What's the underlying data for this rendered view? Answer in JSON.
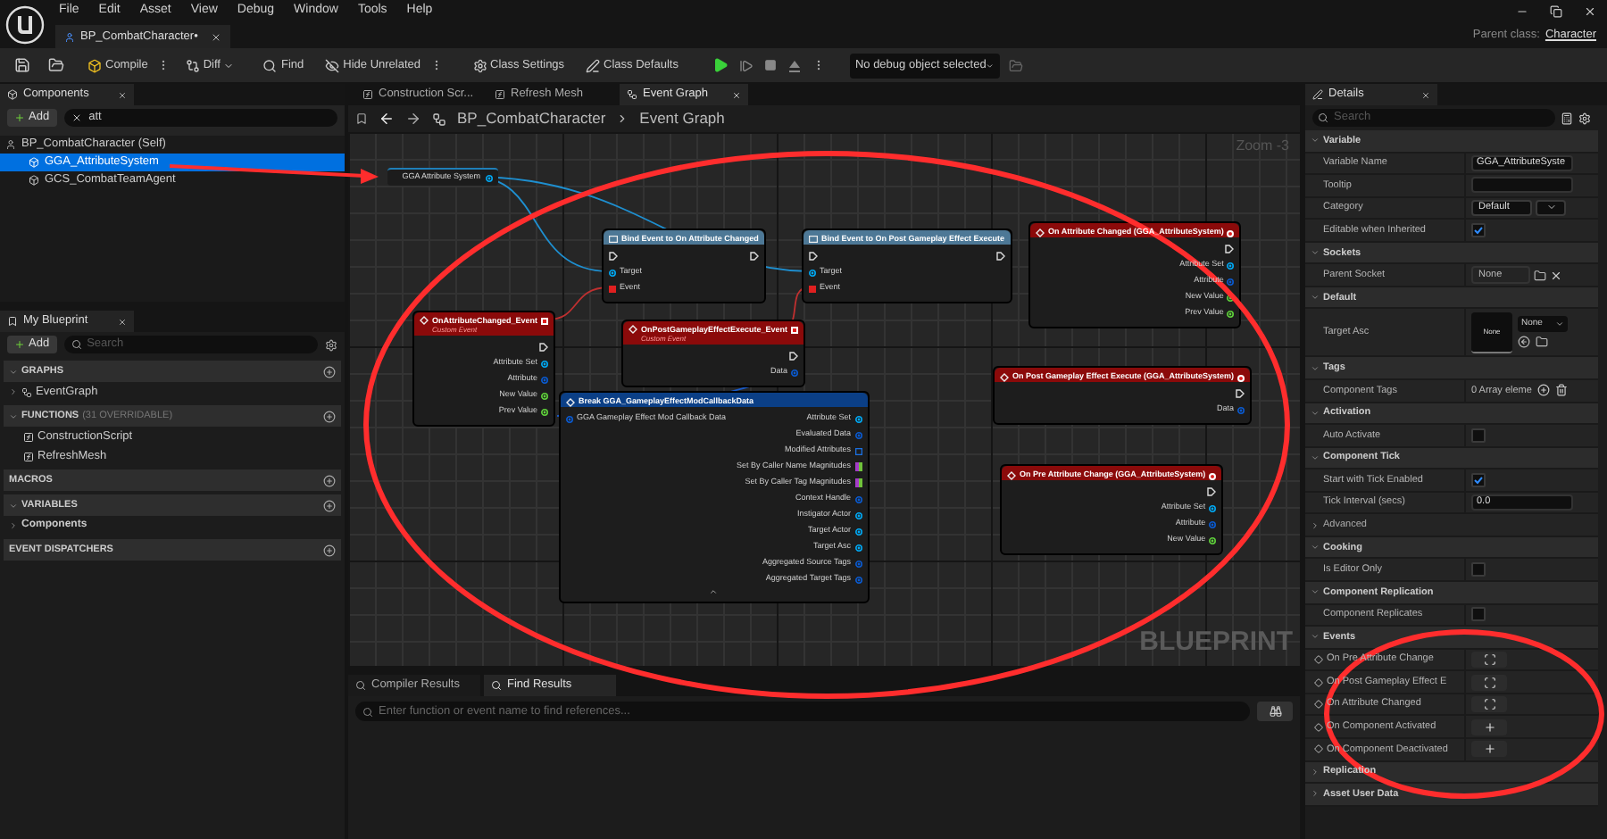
{
  "menu": [
    "File",
    "Edit",
    "Asset",
    "View",
    "Debug",
    "Window",
    "Tools",
    "Help"
  ],
  "document_tab": {
    "title": "BP_CombatCharacter•"
  },
  "parent_class": {
    "label": "Parent class:",
    "value": "Character"
  },
  "toolbar": {
    "buttons": [
      {
        "kind": "compile",
        "label": "Compile"
      },
      {
        "kind": "diff",
        "label": "Diff"
      },
      {
        "kind": "find",
        "label": "Find"
      },
      {
        "kind": "hide",
        "label": "Hide Unrelated"
      },
      {
        "kind": "settings",
        "label": "Class Settings"
      },
      {
        "kind": "defaults",
        "label": "Class Defaults"
      }
    ],
    "debug_selector": "No debug object selected"
  },
  "components": {
    "title": "Components",
    "add": "Add",
    "search": "att",
    "tree": {
      "label": "BP_CombatCharacter (Self)",
      "children": [
        {
          "label": "GGA_AttributeSystem",
          "selected": true
        },
        {
          "label": "GCS_CombatTeamAgent",
          "selected": false
        }
      ]
    }
  },
  "my_blueprint": {
    "title": "My Blueprint",
    "add": "Add",
    "search_placeholder": "Search",
    "sections": [
      {
        "title": "GRAPHS",
        "expanded": true,
        "items": [
          {
            "kind": "graph",
            "label": "EventGraph"
          }
        ]
      },
      {
        "title": "FUNCTIONS",
        "note": "(31 OVERRIDABLE)",
        "expanded": true,
        "items": [
          {
            "kind": "construction",
            "label": "ConstructionScript"
          },
          {
            "kind": "function",
            "label": "RefreshMesh"
          }
        ]
      },
      {
        "title": "MACROS"
      },
      {
        "title": "VARIABLES",
        "expanded": true,
        "items": [
          {
            "kind": "category",
            "label": "Components"
          }
        ]
      },
      {
        "title": "EVENT DISPATCHERS"
      }
    ]
  },
  "graph": {
    "tabs": [
      {
        "kind": "function",
        "label": "Construction Scr...",
        "selected": false
      },
      {
        "kind": "function",
        "label": "Refresh Mesh",
        "selected": false
      },
      {
        "kind": "graph",
        "label": "Event Graph",
        "selected": true
      }
    ],
    "breadcrumb": [
      "BP_CombatCharacter",
      "Event Graph"
    ],
    "zoom": "Zoom -3",
    "watermark": "BLUEPRINT",
    "nodes": [
      {
        "kind": "variable",
        "title": "GGA Attribute System",
        "outputs": [
          {
            "kind": "object"
          }
        ]
      },
      {
        "kind": "function",
        "title": "Bind Event to On Attribute Changed",
        "inputs": [
          {
            "kind": "exec"
          },
          {
            "kind": "object",
            "label": "Target"
          },
          {
            "kind": "delegate",
            "label": "Event"
          }
        ],
        "outputs": [
          {
            "kind": "exec"
          }
        ]
      },
      {
        "kind": "function",
        "title": "Bind Event to On Post Gameplay Effect Execute",
        "inputs": [
          {
            "kind": "exec"
          },
          {
            "kind": "object",
            "label": "Target"
          },
          {
            "kind": "delegate",
            "label": "Event"
          }
        ],
        "outputs": [
          {
            "kind": "exec"
          }
        ]
      },
      {
        "kind": "custom_event",
        "title": "OnAttributeChanged_Event",
        "subtitle": "Custom Event",
        "outputs": [
          {
            "kind": "exec"
          },
          {
            "kind": "object",
            "label": "Attribute Set"
          },
          {
            "kind": "struct",
            "label": "Attribute"
          },
          {
            "kind": "float",
            "label": "New Value"
          },
          {
            "kind": "float",
            "label": "Prev Value"
          }
        ]
      },
      {
        "kind": "custom_event",
        "title": "OnPostGameplayEffectExecute_Event",
        "subtitle": "Custom Event",
        "outputs": [
          {
            "kind": "exec"
          },
          {
            "kind": "struct",
            "label": "Data"
          }
        ]
      },
      {
        "kind": "break",
        "title": "Break GGA_GameplayEffectModCallbackData",
        "inputs": [
          {
            "kind": "struct",
            "label": "GGA Gameplay Effect Mod Callback Data"
          }
        ],
        "outputs": [
          {
            "kind": "object",
            "label": "Attribute Set"
          },
          {
            "kind": "struct",
            "label": "Evaluated Data"
          },
          {
            "kind": "set",
            "label": "Modified Attributes"
          },
          {
            "kind": "map",
            "label": "Set By Caller Name Magnitudes"
          },
          {
            "kind": "map",
            "label": "Set By Caller Tag Magnitudes"
          },
          {
            "kind": "struct",
            "label": "Context Handle"
          },
          {
            "kind": "object",
            "label": "Instigator Actor"
          },
          {
            "kind": "object",
            "label": "Target Actor"
          },
          {
            "kind": "object",
            "label": "Target Asc"
          },
          {
            "kind": "struct",
            "label": "Aggregated Source Tags"
          },
          {
            "kind": "struct",
            "label": "Aggregated Target Tags"
          }
        ]
      },
      {
        "kind": "event",
        "title": "On Attribute Changed (GGA_AttributeSystem)",
        "outputs": [
          {
            "kind": "exec"
          },
          {
            "kind": "object",
            "label": "Attribute Set"
          },
          {
            "kind": "struct",
            "label": "Attribute"
          },
          {
            "kind": "float",
            "label": "New Value"
          },
          {
            "kind": "float",
            "label": "Prev Value"
          }
        ]
      },
      {
        "kind": "event",
        "title": "On Post Gameplay Effect Execute (GGA_AttributeSystem)",
        "outputs": [
          {
            "kind": "exec"
          },
          {
            "kind": "struct",
            "label": "Data"
          }
        ]
      },
      {
        "kind": "event",
        "title": "On Pre Attribute Change (GGA_AttributeSystem)",
        "outputs": [
          {
            "kind": "exec"
          },
          {
            "kind": "object",
            "label": "Attribute Set"
          },
          {
            "kind": "struct",
            "label": "Attribute"
          },
          {
            "kind": "float",
            "label": "New Value"
          }
        ]
      }
    ]
  },
  "bottom_panel": {
    "tabs": [
      {
        "label": "Compiler Results",
        "selected": false
      },
      {
        "label": "Find Results",
        "selected": true
      }
    ],
    "search_placeholder": "Enter function or event name to find references..."
  },
  "details": {
    "title": "Details",
    "search_placeholder": "Search",
    "sections": [
      {
        "title": "Variable",
        "expanded": true,
        "rows": [
          {
            "kind": "text",
            "label": "Variable Name",
            "value": "GGA_AttributeSyste"
          },
          {
            "kind": "text",
            "label": "Tooltip"
          },
          {
            "kind": "dropdown",
            "label": "Category",
            "value": "Default"
          },
          {
            "kind": "checkbox",
            "label": "Editable when Inherited",
            "checked": true
          }
        ]
      },
      {
        "title": "Sockets",
        "expanded": true,
        "rows": [
          {
            "kind": "socket",
            "label": "Parent Socket",
            "value": "None"
          }
        ]
      },
      {
        "title": "Default",
        "expanded": true,
        "rows": [
          {
            "kind": "asset",
            "label": "Target Asc",
            "value": "None",
            "choice": "None"
          }
        ]
      },
      {
        "title": "Tags",
        "expanded": true,
        "rows": [
          {
            "kind": "array",
            "label": "Component Tags",
            "value": "0 Array eleme"
          }
        ]
      },
      {
        "title": "Activation",
        "expanded": true,
        "rows": [
          {
            "kind": "checkbox",
            "label": "Auto Activate",
            "checked": false
          }
        ]
      },
      {
        "title": "Component Tick",
        "expanded": true,
        "rows": [
          {
            "kind": "checkbox",
            "label": "Start with Tick Enabled",
            "checked": true
          },
          {
            "kind": "text",
            "label": "Tick Interval (secs)",
            "value": "0.0"
          },
          {
            "kind": "subsection",
            "label": "Advanced"
          }
        ]
      },
      {
        "title": "Cooking",
        "expanded": true,
        "rows": [
          {
            "kind": "checkbox",
            "label": "Is Editor Only",
            "checked": false
          }
        ]
      },
      {
        "title": "Component Replication",
        "expanded": true,
        "rows": [
          {
            "kind": "checkbox",
            "label": "Component Replicates",
            "checked": false
          }
        ]
      },
      {
        "title": "Events",
        "expanded": true,
        "rows": [
          {
            "kind": "event",
            "label": "On Pre Attribute Change",
            "bound": true
          },
          {
            "kind": "event",
            "label": "On Post Gameplay Effect E",
            "bound": true
          },
          {
            "kind": "event",
            "label": "On Attribute Changed",
            "bound": true
          },
          {
            "kind": "event",
            "label": "On Component Activated",
            "bound": false
          },
          {
            "kind": "event",
            "label": "On Component Deactivated",
            "bound": false
          }
        ]
      },
      {
        "title": "Replication",
        "expanded": false
      },
      {
        "title": "Asset User Data",
        "expanded": false
      }
    ]
  }
}
